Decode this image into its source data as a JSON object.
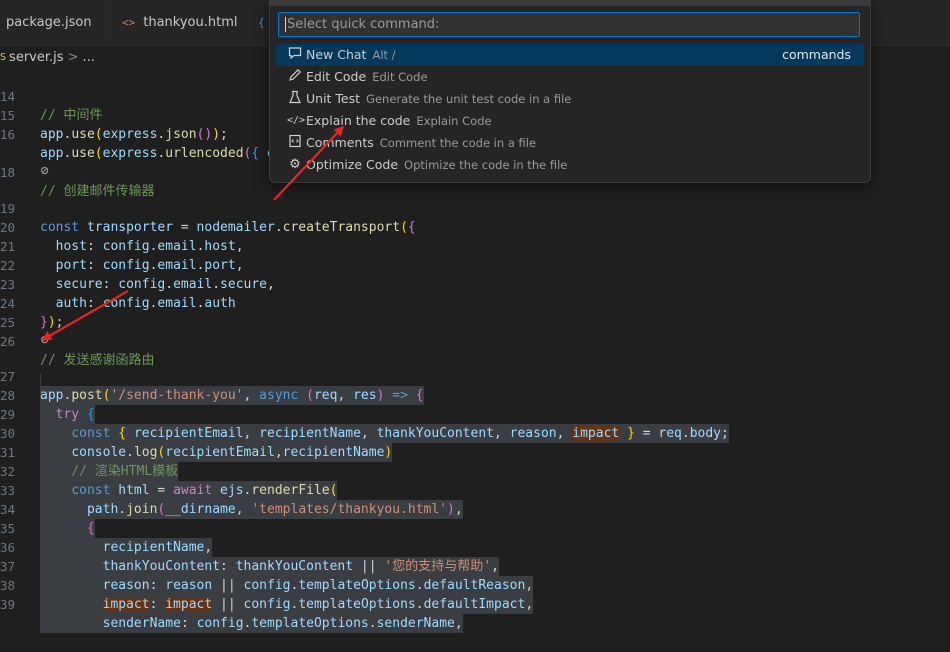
{
  "tabs": [
    {
      "icon": "{ }",
      "label": "package.json"
    },
    {
      "icon": "<>",
      "label": "thankyou.html"
    },
    {
      "icon": "{",
      "label": ""
    }
  ],
  "breadcrumb": {
    "icon": "JS",
    "file": "server.js",
    "sep": ">",
    "more": "..."
  },
  "palette": {
    "placeholder": "Select quick command:",
    "commands": [
      {
        "icon": "chat-icon",
        "label": "New Chat",
        "keybinding": "Alt /",
        "description": "",
        "tag": "commands",
        "active": true
      },
      {
        "icon": "pencil-icon",
        "label": "Edit Code",
        "keybinding": "",
        "description": "Edit Code",
        "active": false
      },
      {
        "icon": "beaker-icon",
        "label": "Unit Test",
        "keybinding": "",
        "description": "Generate the unit test code in a file",
        "active": false
      },
      {
        "icon": "code-icon",
        "label": "Explain the code",
        "keybinding": "",
        "description": "Explain Code",
        "active": false
      },
      {
        "icon": "comment-icon",
        "label": "Comments",
        "keybinding": "",
        "description": "Comment the code in a file",
        "active": false
      },
      {
        "icon": "gear-icon",
        "label": "Optimize Code",
        "keybinding": "",
        "description": "Optimize the code in the file",
        "active": false
      }
    ]
  },
  "editor": {
    "line_numbers": [
      "14",
      "15",
      "16",
      "18",
      "19",
      "20",
      "21",
      "22",
      "23",
      "24",
      "25",
      "26",
      "27",
      "28",
      "29",
      "30",
      "31",
      "32",
      "33",
      "34",
      "35",
      "36",
      "37",
      "38",
      "39"
    ],
    "lines": [
      "// 中间件",
      "app.use(express.json());",
      "app.use(express.urlencoded({ e",
      "// 创建邮件传输器",
      "const transporter = nodemailer.createTransport({",
      "  host: config.email.host,",
      "  port: config.email.port,",
      "  secure: config.email.secure,",
      "  auth: config.email.auth",
      "});",
      "",
      "// 发送感谢函路由",
      "app.post('/send-thank-you', async (req, res) => {",
      "  try {",
      "    const { recipientEmail, recipientName, thankYouContent, reason, impact } = req.body;",
      "    console.log(recipientEmail,recipientName)",
      "    // 渲染HTML模板",
      "    const html = await ejs.renderFile(",
      "      path.join(__dirname, 'templates/thankyou.html'),",
      "      {",
      "        recipientName,",
      "        thankYouContent: thankYouContent || '您的支持与帮助',",
      "        reason: reason || config.templateOptions.defaultReason,",
      "        impact: impact || config.templateOptions.defaultImpact,",
      "        senderName: config.templateOptions.senderName,"
    ]
  },
  "annotations": {
    "arrow_color": "#e8261f"
  }
}
